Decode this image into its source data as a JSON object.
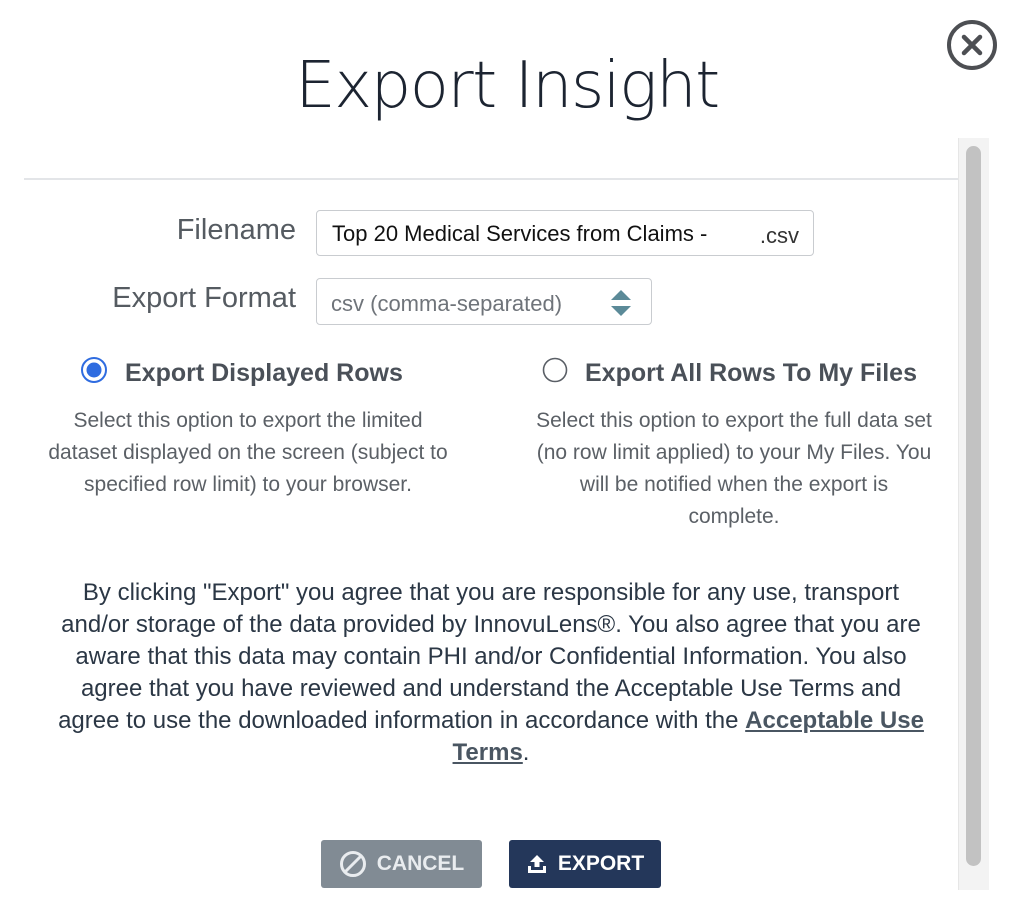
{
  "dialog": {
    "title": "Export Insight",
    "close_icon": "close-circle-icon"
  },
  "form": {
    "filename_label": "Filename",
    "filename_value": "Top 20 Medical Services from Claims -",
    "filename_extension": ".csv",
    "format_label": "Export Format",
    "format_selected": "csv (comma-separated)"
  },
  "options": {
    "displayed": {
      "label": "Export Displayed Rows",
      "description": "Select this option to export the limited dataset displayed on the screen (subject to specified row limit) to your browser.",
      "checked": true
    },
    "all": {
      "label": "Export All Rows To My Files",
      "description": "Select this option to export the full data set (no row limit applied) to your My Files. You will be notified when the export is complete.",
      "checked": false
    }
  },
  "agreement": {
    "text": "By clicking \"Export\" you agree that you are responsible for any use, transport and/or storage of the data provided by InnovuLens®. You also agree that you are aware that this data may contain PHI and/or Confidential Information. You also agree that you have reviewed and understand the Acceptable Use Terms and agree to use the downloaded information in accordance with the",
    "link_text": "Acceptable Use Terms",
    "suffix": "."
  },
  "buttons": {
    "cancel_label": "CANCEL",
    "cancel_icon": "ban-icon",
    "export_label": "EXPORT",
    "export_icon": "upload-icon"
  },
  "colors": {
    "radio_selected": "#2f6ce0",
    "select_arrows": "#5b8a98",
    "cancel_bg": "#818b94",
    "export_bg": "#24375a"
  }
}
